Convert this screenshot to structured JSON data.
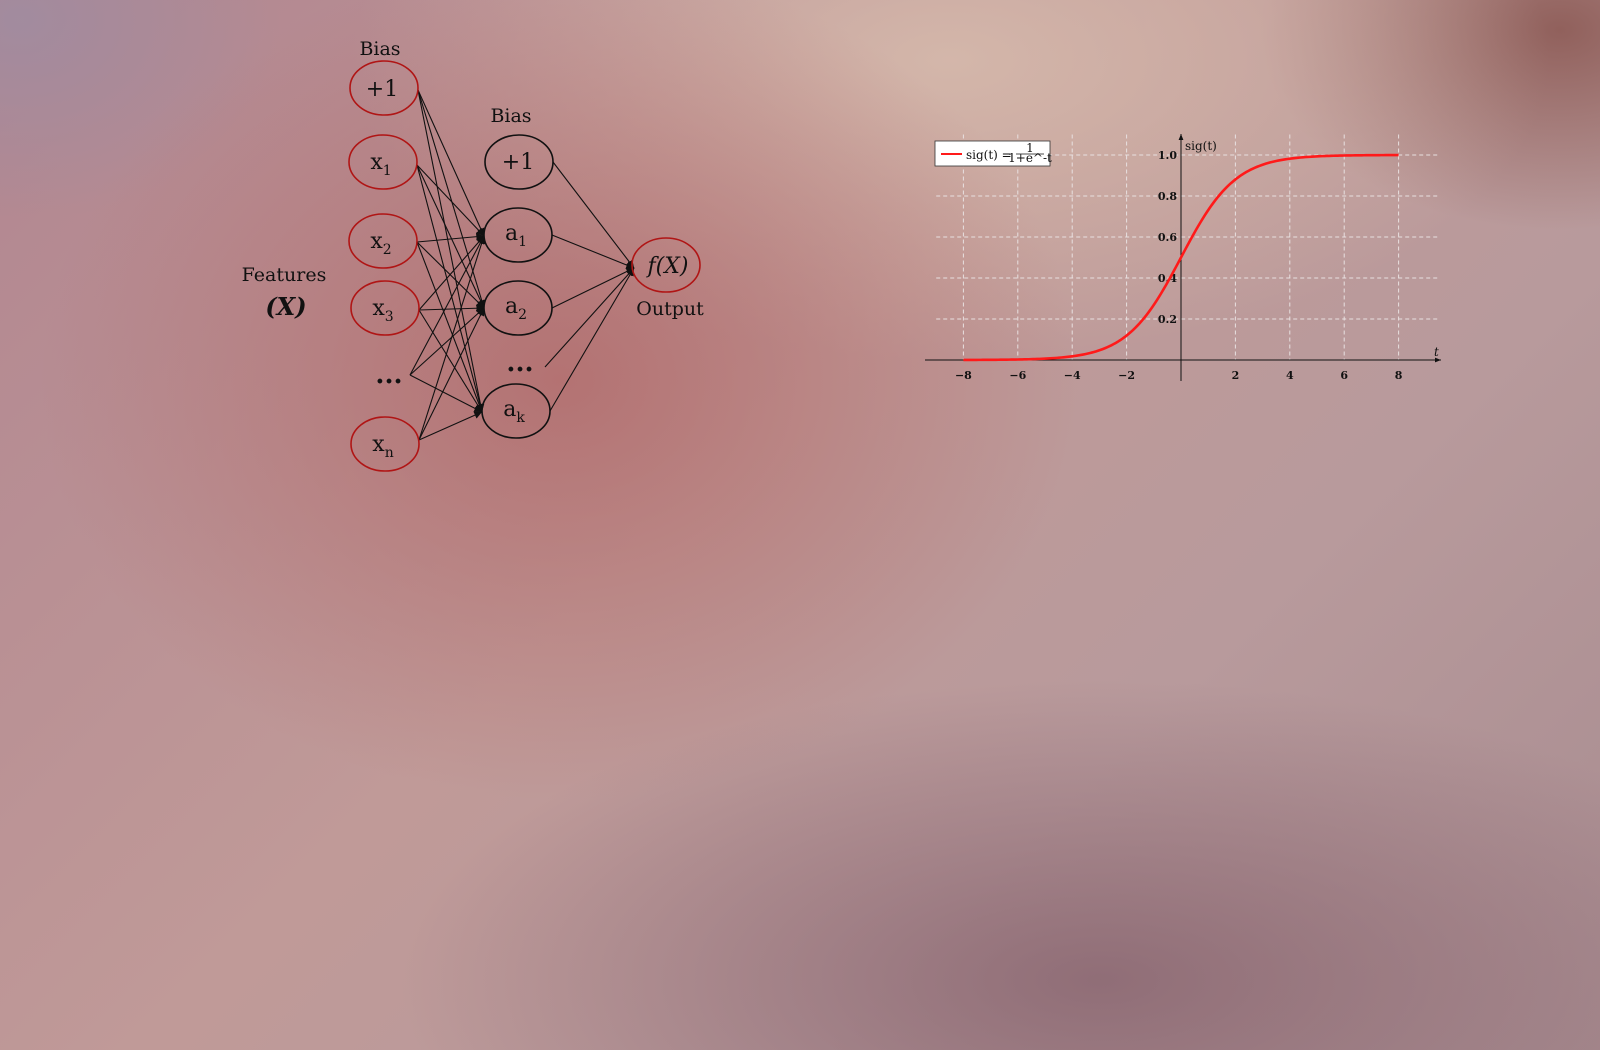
{
  "network": {
    "input_bias_label": "Bias",
    "hidden_bias_label": "Bias",
    "features_label": "Features",
    "features_symbol": "(X)",
    "output_label": "Output",
    "output_node": "f(X)",
    "input_nodes": [
      {
        "main": "+1",
        "sub": ""
      },
      {
        "main": "x",
        "sub": "1"
      },
      {
        "main": "x",
        "sub": "2"
      },
      {
        "main": "x",
        "sub": "3"
      },
      {
        "main": "...",
        "sub": ""
      },
      {
        "main": "x",
        "sub": "n"
      }
    ],
    "hidden_nodes": [
      {
        "main": "+1",
        "sub": ""
      },
      {
        "main": "a",
        "sub": "1"
      },
      {
        "main": "a",
        "sub": "2"
      },
      {
        "main": "...",
        "sub": ""
      },
      {
        "main": "a",
        "sub": "k"
      }
    ],
    "colors": {
      "input_node_stroke": "#b01515",
      "hidden_node_stroke": "#111111",
      "output_node_stroke": "#b01515"
    }
  },
  "chart_data": {
    "type": "line",
    "function": "sigmoid",
    "series": [
      {
        "name": "sig(t) = 1/(1+e^-t)",
        "x_range": [
          -8,
          8
        ],
        "color": "#ff1a1a"
      }
    ],
    "legend": {
      "prefix": "sig(t) = ",
      "numerator": "1",
      "denominator": "1+e^-t",
      "placement": "top-left"
    },
    "xlabel": "t",
    "ylabel": "sig(t)",
    "xlim": [
      -9,
      9.5
    ],
    "ylim": [
      0,
      1.1
    ],
    "x_ticks": [
      "−8",
      "−6",
      "−4",
      "−2",
      "2",
      "4",
      "6",
      "8"
    ],
    "y_ticks": [
      "0.2",
      "0.4",
      "0.6",
      "0.8",
      "1.0"
    ],
    "grid": true
  }
}
